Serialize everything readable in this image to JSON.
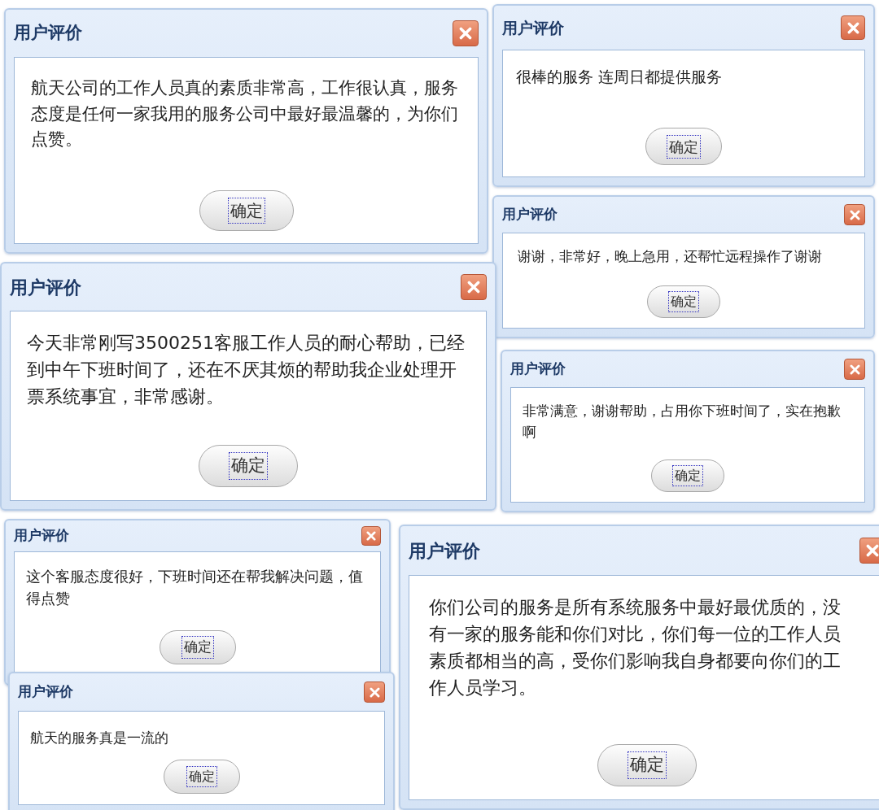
{
  "dialogs": [
    {
      "title": "用户评价",
      "message": "航天公司的工作人员真的素质非常高，工作很认真，服务态度是任何一家我用的服务公司中最好最温馨的，为你们点赞。",
      "button": "确定"
    },
    {
      "title": "用户评价",
      "message": "很棒的服务 连周日都提供服务",
      "button": "确定"
    },
    {
      "title": "用户评价",
      "message": "谢谢，非常好，晚上急用，还帮忙远程操作了谢谢",
      "button": "确定"
    },
    {
      "title": "用户评价",
      "message": "今天非常刚写3500251客服工作人员的耐心帮助，已经到中午下班时间了，还在不厌其烦的帮助我企业处理开票系统事宜，非常感谢。",
      "button": "确定"
    },
    {
      "title": "用户评价",
      "message": "非常满意，谢谢帮助，占用你下班时间了，实在抱歉啊",
      "button": "确定"
    },
    {
      "title": "用户评价",
      "message": "这个客服态度很好，下班时间还在帮我解决问题，值得点赞",
      "button": "确定"
    },
    {
      "title": "用户评价",
      "message": "航天的服务真是一流的",
      "button": "确定"
    },
    {
      "title": "用户评价",
      "message": "你们公司的服务是所有系统服务中最好最优质的，没有一家的服务能和你们对比，你们每一位的工作人员素质都相当的高，受你们影响我自身都要向你们的工作人员学习。",
      "button": "确定"
    }
  ]
}
